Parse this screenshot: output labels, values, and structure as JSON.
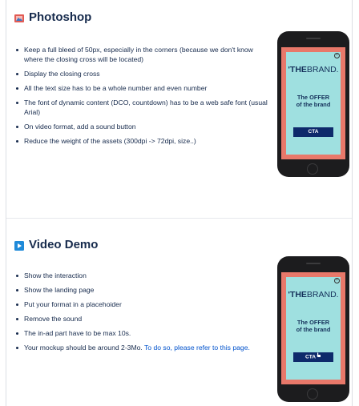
{
  "photoshop": {
    "title": "Photoshop",
    "items": [
      "Keep a full bleed of 50px, especially in the corners (because we don't know where the closing cross will be located)",
      "Display the closing cross",
      "All the text size has to be a whole number and even number",
      "The font of dynamic content (DCO, countdown) has to be a web safe font (usual Arial)",
      "On video format, add a sound button",
      "Reduce the weight of the assets (300dpi -> 72dpi, size..)"
    ]
  },
  "video_demo": {
    "title": "Video Demo",
    "items": [
      "Show the interaction",
      "Show the landing page",
      "Put your format in a placehoider",
      "Remove the sound",
      "The in-ad part have to be max 10s."
    ],
    "last_item_text": "Your mockup should be around 2-3Mo. ",
    "last_item_link": "To do so, please refer to this page."
  },
  "mockup": {
    "brand_bold": "'THE",
    "brand_thin": "BRAND.",
    "offer_line1": "The OFFER",
    "offer_line2": "of the brand",
    "cta_label": "CTA",
    "close_glyph": "×"
  },
  "colors": {
    "phone_body": "#1c1c1e",
    "screen_border": "#e8786a",
    "screen_bg": "#9fe0e0",
    "cta_bg": "#0e2a6b",
    "link": "#0052cc",
    "photoshop_icon": "#e15b54",
    "video_icon": "#1f8ad9"
  },
  "icons": [
    "image-icon",
    "play-icon"
  ]
}
